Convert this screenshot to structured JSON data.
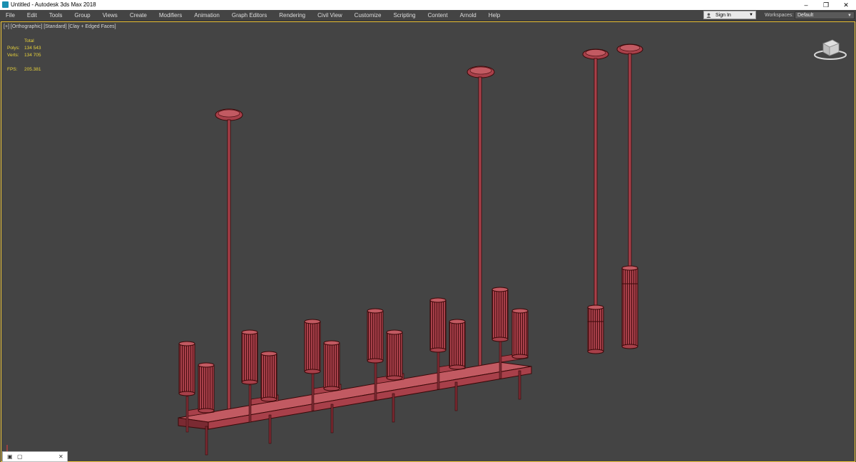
{
  "window": {
    "title": "Untitled - Autodesk 3ds Max 2018",
    "controls": [
      "–",
      "❐",
      "✕"
    ]
  },
  "menu": [
    "File",
    "Edit",
    "Tools",
    "Group",
    "Views",
    "Create",
    "Modifiers",
    "Animation",
    "Graph Editors",
    "Rendering",
    "Civil View",
    "Customize",
    "Scripting",
    "Content",
    "Arnold",
    "Help"
  ],
  "account": {
    "sign_in": "Sign In"
  },
  "workspaces": {
    "label": "Workspaces:",
    "value": "Default"
  },
  "viewport": {
    "label": "[+] [Orthographic] [Standard] [Clay + Edged Faces]",
    "stats": {
      "header": "Total",
      "polys_label": "Polys:",
      "polys": "134 543",
      "verts_label": "Verts:",
      "verts": "134 705",
      "fps_label": "FPS:",
      "fps": "205.381"
    }
  },
  "colors": {
    "wire": "#3a0808",
    "shade": "#a8404a",
    "shade_dark": "#7a2a32",
    "shade_light": "#c25a62",
    "viewport_border": "#f0c63a",
    "stats_text": "#e8d23a"
  },
  "icons": [
    "app-icon",
    "user-icon",
    "view-cube-icon",
    "axis-tripod-icon"
  ]
}
